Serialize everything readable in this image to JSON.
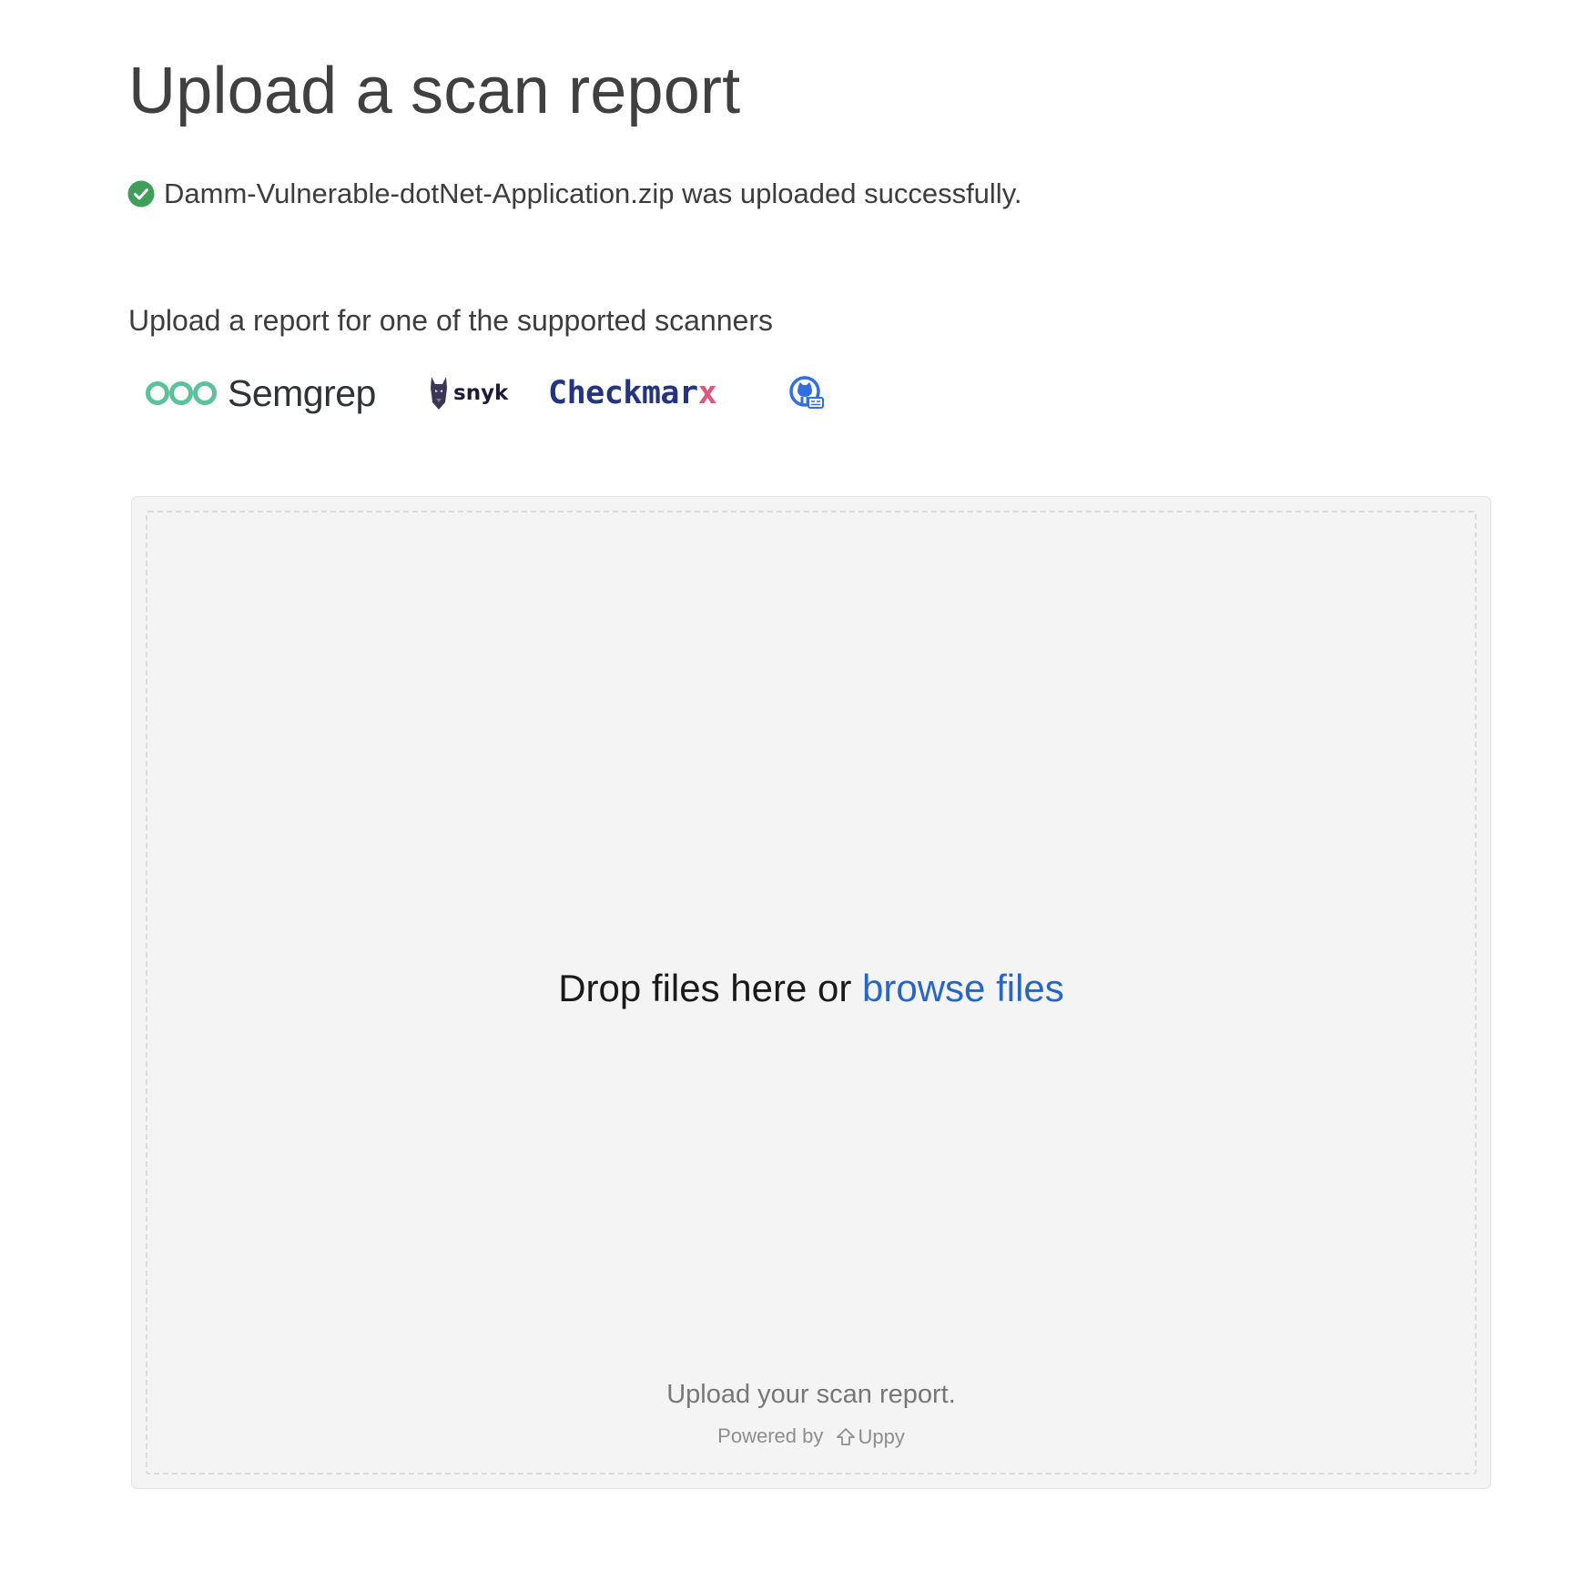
{
  "page": {
    "title": "Upload a scan report"
  },
  "status": {
    "message": "Damm-Vulnerable-dotNet-Application.zip was uploaded successfully.",
    "icon": "check-circle-icon",
    "color": "#3f9f5a"
  },
  "scanners": {
    "intro": "Upload a report for one of the supported scanners",
    "logos": [
      {
        "name": "Semgrep",
        "icon": "semgrep-logo",
        "color": "#5cc29b"
      },
      {
        "name": "snyk",
        "icon": "snyk-logo",
        "color": "#1e1b3a"
      },
      {
        "name": "Checkmarx",
        "wordmark": "Checkmar",
        "accent": "x",
        "icon": "checkmarx-logo",
        "color": "#243580",
        "accent_color": "#e0567a"
      },
      {
        "name": "GitHub Code Scanning",
        "icon": "github-logo",
        "color": "#2f6fe0"
      }
    ]
  },
  "dropzone": {
    "prompt": "Drop files here or ",
    "browse_label": "browse files",
    "note": "Upload your scan report.",
    "powered_by": "Powered by",
    "brand": "Uppy",
    "link_color": "#2766c9"
  }
}
